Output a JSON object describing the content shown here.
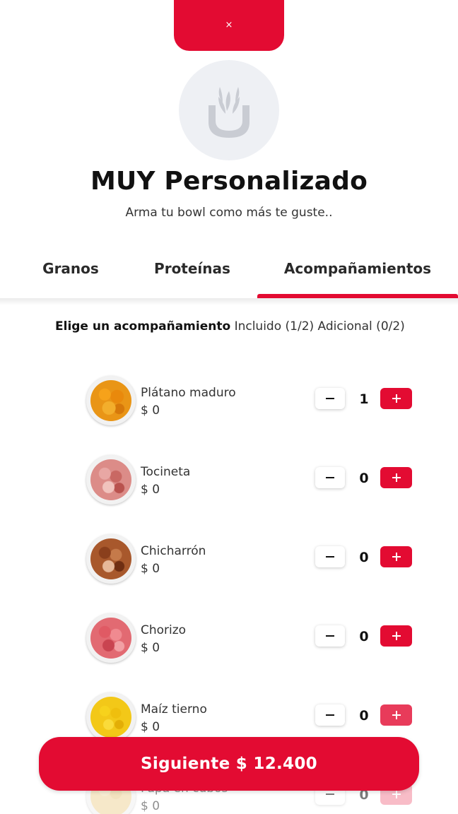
{
  "close_button": {
    "label": "×"
  },
  "header": {
    "title": "MUY Personalizado",
    "subtitle": "Arma tu bowl como más te guste.."
  },
  "tabs": [
    {
      "label": "Granos",
      "active": false
    },
    {
      "label": "Proteínas",
      "active": false
    },
    {
      "label": "Acompañamientos",
      "active": true
    }
  ],
  "instruction": {
    "prompt": "Elige un acompañamiento",
    "included": "Incluido (1/2)",
    "additional": "Adicional (0/2)"
  },
  "items": [
    {
      "name": "Plátano maduro",
      "price": "$ 0",
      "qty": "1"
    },
    {
      "name": "Tocineta",
      "price": "$ 0",
      "qty": "0"
    },
    {
      "name": "Chicharrón",
      "price": "$ 0",
      "qty": "0"
    },
    {
      "name": "Chorizo",
      "price": "$ 0",
      "qty": "0"
    },
    {
      "name": "Maíz tierno",
      "price": "$ 0",
      "qty": "0"
    },
    {
      "name": "Papa en cubos",
      "price": "$ 0",
      "qty": "0"
    }
  ],
  "next_button": {
    "label": "Siguiente $ 12.400"
  },
  "colors": {
    "accent": "#e30b32",
    "logo_bg": "#eef0f4",
    "logo_icon": "#c9ccd3"
  },
  "icons": {
    "logo": "bowl-sprout-icon",
    "minus": "minus-icon",
    "plus": "plus-icon",
    "close": "close-icon"
  }
}
